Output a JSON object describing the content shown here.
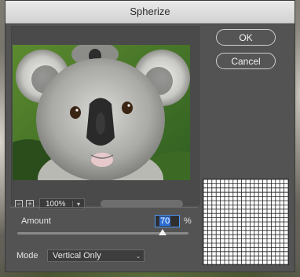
{
  "dialog": {
    "title": "Spherize",
    "ok_label": "OK",
    "cancel_label": "Cancel"
  },
  "preview": {
    "zoom": "100%",
    "zoom_out_glyph": "−",
    "zoom_in_glyph": "+",
    "dropdown_glyph": "▾"
  },
  "amount": {
    "label": "Amount",
    "value": "70",
    "unit": "%",
    "slider_value_fraction": 0.85
  },
  "mode": {
    "label": "Mode",
    "selected": "Vertical Only",
    "chevron": "⌄"
  },
  "grid": {
    "columns": 20,
    "rows": 20,
    "line_color": "#222222"
  },
  "colors": {
    "accent_blue": "#4f9bff",
    "dialog_bg": "#535353",
    "foliage_green": "#3f7a2c"
  }
}
